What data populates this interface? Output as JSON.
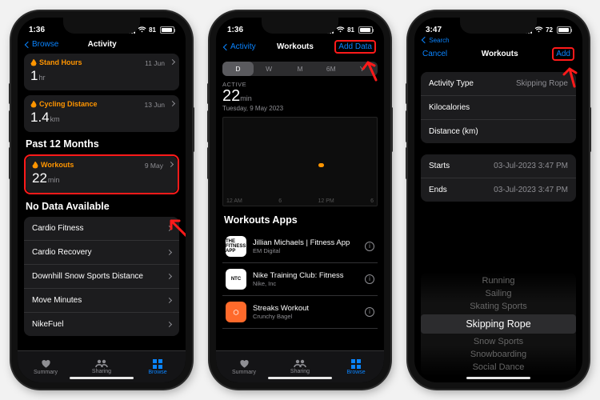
{
  "s1": {
    "time": "1:36",
    "batt": "81",
    "back": "Browse",
    "title": "Activity",
    "c1": {
      "lbl": "Stand Hours",
      "date": "11 Jun",
      "val": "1",
      "unit": "hr"
    },
    "c2": {
      "lbl": "Cycling Distance",
      "date": "13 Jun",
      "val": "1.4",
      "unit": "km"
    },
    "sect1": "Past 12 Months",
    "c3": {
      "lbl": "Workouts",
      "date": "9 May",
      "val": "22",
      "unit": "min"
    },
    "sect2": "No Data Available",
    "rows": [
      "Cardio Fitness",
      "Cardio Recovery",
      "Downhill Snow Sports Distance",
      "Move Minutes",
      "NikeFuel"
    ],
    "tabs": [
      "Summary",
      "Sharing",
      "Browse"
    ]
  },
  "s2": {
    "time": "1:36",
    "batt": "81",
    "back": "Activity",
    "title": "Workouts",
    "act": "Add Data",
    "seg": [
      "D",
      "W",
      "M",
      "6M",
      "Y"
    ],
    "hero_lbl": "ACTIVE",
    "hero_val": "22",
    "hero_unit": "min",
    "hero_date": "Tuesday, 9 May 2023",
    "axis": [
      "12 AM",
      "6",
      "12 PM",
      "6"
    ],
    "apps_title": "Workouts Apps",
    "apps": [
      {
        "name": "Jillian Michaels | Fitness App",
        "dev": "EM Digital",
        "bg": "#fff",
        "fg": "#000",
        "txt": "THE FITNESS APP"
      },
      {
        "name": "Nike Training Club: Fitness",
        "dev": "Nike, Inc",
        "bg": "#fff",
        "fg": "#000",
        "txt": "NTC"
      },
      {
        "name": "Streaks Workout",
        "dev": "Crunchy Bagel",
        "bg": "#ff6a2b",
        "fg": "#fff",
        "txt": "◯"
      }
    ]
  },
  "s3": {
    "time": "3:47",
    "batt": "72",
    "search": "Search",
    "cancel": "Cancel",
    "title": "Workouts",
    "act": "Add",
    "rows1": [
      {
        "l": "Activity Type",
        "v": "Skipping Rope"
      },
      {
        "l": "Kilocalories",
        "v": ""
      },
      {
        "l": "Distance (km)",
        "v": ""
      }
    ],
    "rows2": [
      {
        "l": "Starts",
        "v": "03-Jul-2023  3:47 PM"
      },
      {
        "l": "Ends",
        "v": "03-Jul-2023  3:47 PM"
      }
    ],
    "picker": [
      "Running",
      "Sailing",
      "Skating Sports",
      "Skipping Rope",
      "Snow Sports",
      "Snowboarding",
      "Social Dance"
    ],
    "sel": 3
  }
}
